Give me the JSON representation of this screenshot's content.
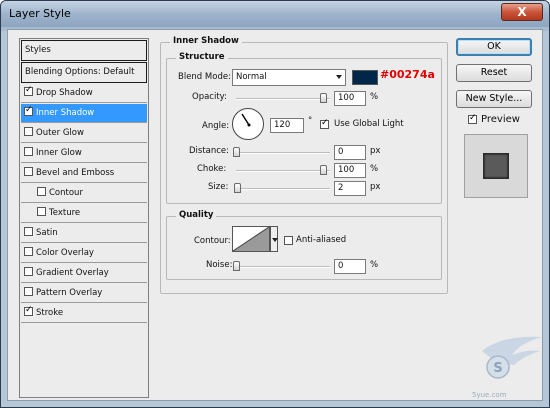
{
  "window": {
    "title": "Layer Style",
    "close_glyph": "X"
  },
  "styles_panel": {
    "items": [
      {
        "label": "Styles",
        "type": "header"
      },
      {
        "label": "Blending Options: Default",
        "type": "header"
      },
      {
        "label": "Drop Shadow",
        "checked": true
      },
      {
        "label": "Inner Shadow",
        "checked": true,
        "selected": true
      },
      {
        "label": "Outer Glow",
        "checked": false
      },
      {
        "label": "Inner Glow",
        "checked": false
      },
      {
        "label": "Bevel and Emboss",
        "checked": false
      },
      {
        "label": "Contour",
        "checked": false,
        "indent": true
      },
      {
        "label": "Texture",
        "checked": false,
        "indent": true
      },
      {
        "label": "Satin",
        "checked": false
      },
      {
        "label": "Color Overlay",
        "checked": false
      },
      {
        "label": "Gradient Overlay",
        "checked": false
      },
      {
        "label": "Pattern Overlay",
        "checked": false
      },
      {
        "label": "Stroke",
        "checked": true
      }
    ]
  },
  "inner_shadow": {
    "section_title": "Inner Shadow",
    "structure": {
      "title": "Structure",
      "blend_mode_label": "Blend Mode:",
      "blend_mode_value": "Normal",
      "color_hex": "#00274a",
      "color_note": "#00274a",
      "opacity_label": "Opacity:",
      "opacity_value": "100",
      "opacity_unit": "%",
      "opacity_level": 1.0,
      "angle_label": "Angle:",
      "angle_value": "120",
      "angle_unit": "°",
      "use_global_light_label": "Use Global Light",
      "use_global_light_checked": true,
      "distance_label": "Distance:",
      "distance_value": "0",
      "distance_unit": "px",
      "distance_level": 0.0,
      "choke_label": "Choke:",
      "choke_value": "100",
      "choke_unit": "%",
      "choke_level": 1.0,
      "size_label": "Size:",
      "size_value": "2",
      "size_unit": "px",
      "size_level": 0.01
    },
    "quality": {
      "title": "Quality",
      "contour_label": "Contour:",
      "anti_aliased_label": "Anti-aliased",
      "anti_aliased_checked": false,
      "noise_label": "Noise:",
      "noise_value": "0",
      "noise_unit": "%",
      "noise_level": 0.0
    }
  },
  "buttons": {
    "ok": "OK",
    "reset": "Reset",
    "new_style": "New Style...",
    "preview_label": "Preview",
    "preview_checked": true
  },
  "watermark": {
    "text": "5yue.com"
  }
}
